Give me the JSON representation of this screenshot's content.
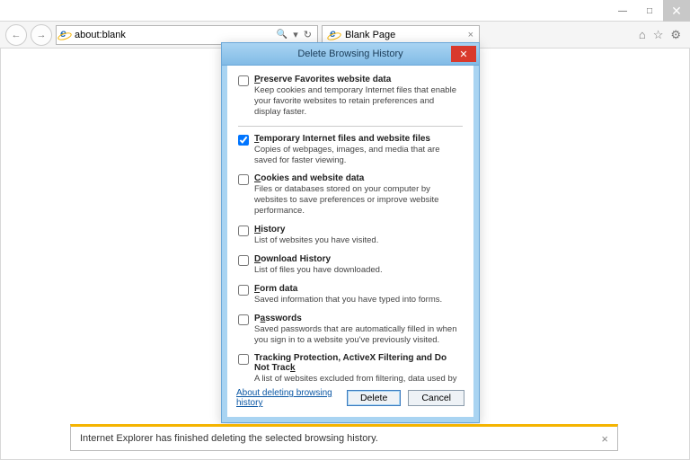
{
  "window": {
    "min": "—",
    "max": "□",
    "close": "✕"
  },
  "nav": {
    "back": "←",
    "fwd": "→",
    "url": "about:blank",
    "refresh": "↻",
    "search": "🔍",
    "dropdown": "▾"
  },
  "tab": {
    "title": "Blank Page",
    "close": "×"
  },
  "icons": {
    "home": "⌂",
    "star": "☆",
    "gear": "⚙"
  },
  "dialog": {
    "title": "Delete Browsing History",
    "close": "✕",
    "options": [
      {
        "checked": false,
        "label_pre": "",
        "mn": "P",
        "label_post": "reserve Favorites website data",
        "desc": "Keep cookies and temporary Internet files that enable your favorite websites to retain preferences and display faster."
      },
      {
        "checked": true,
        "label_pre": "",
        "mn": "T",
        "label_post": "emporary Internet files and website files",
        "desc": "Copies of webpages, images, and media that are saved for faster viewing."
      },
      {
        "checked": false,
        "label_pre": "",
        "mn": "C",
        "label_post": "ookies and website data",
        "desc": "Files or databases stored on your computer by websites to save preferences or improve website performance."
      },
      {
        "checked": false,
        "label_pre": "",
        "mn": "H",
        "label_post": "istory",
        "desc": "List of websites you have visited."
      },
      {
        "checked": false,
        "label_pre": "",
        "mn": "D",
        "label_post": "ownload History",
        "desc": "List of files you have downloaded."
      },
      {
        "checked": false,
        "label_pre": "",
        "mn": "F",
        "label_post": "orm data",
        "desc": "Saved information that you have typed into forms."
      },
      {
        "checked": false,
        "label_pre": "P",
        "mn": "a",
        "label_post": "sswords",
        "desc": "Saved passwords that are automatically filled in when you sign in to a website you've previously visited."
      },
      {
        "checked": false,
        "label_pre": "Tracking Protection, ActiveX Filtering and Do Not Trac",
        "mn": "k",
        "label_post": "",
        "desc": "A list of websites excluded from filtering, data used by Tracking Protection to detect where sites might automatically be sharing details about your visit, and exceptions to Do Not Track requests."
      }
    ],
    "about_link": "About deleting browsing history",
    "delete_btn": "Delete",
    "cancel_btn": "Cancel"
  },
  "notification": {
    "text": "Internet Explorer has finished deleting the selected browsing history.",
    "close": "×"
  }
}
